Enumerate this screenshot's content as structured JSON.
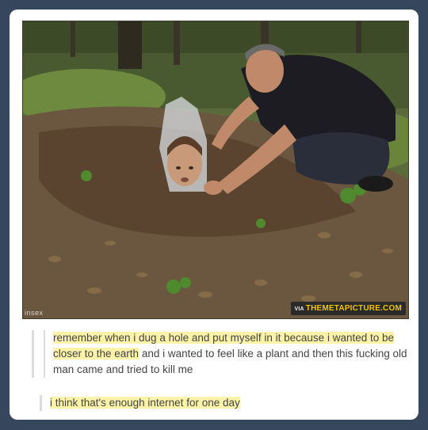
{
  "post": {
    "watermark_left": "insex",
    "watermark_via": "VIA",
    "watermark_site": "THEMETAPICTURE.COM",
    "quote_highlight_1": "remember when i dug a hole and put myself in it because i wanted to be closer to the earth",
    "quote_plain": " and i wanted to feel like a plant and then this fucking old man came and tried to kill me",
    "reply": "i think that's enough internet for one day"
  },
  "colors": {
    "background": "#36465d",
    "card": "#ffffff",
    "highlight": "#fcf3a8"
  }
}
